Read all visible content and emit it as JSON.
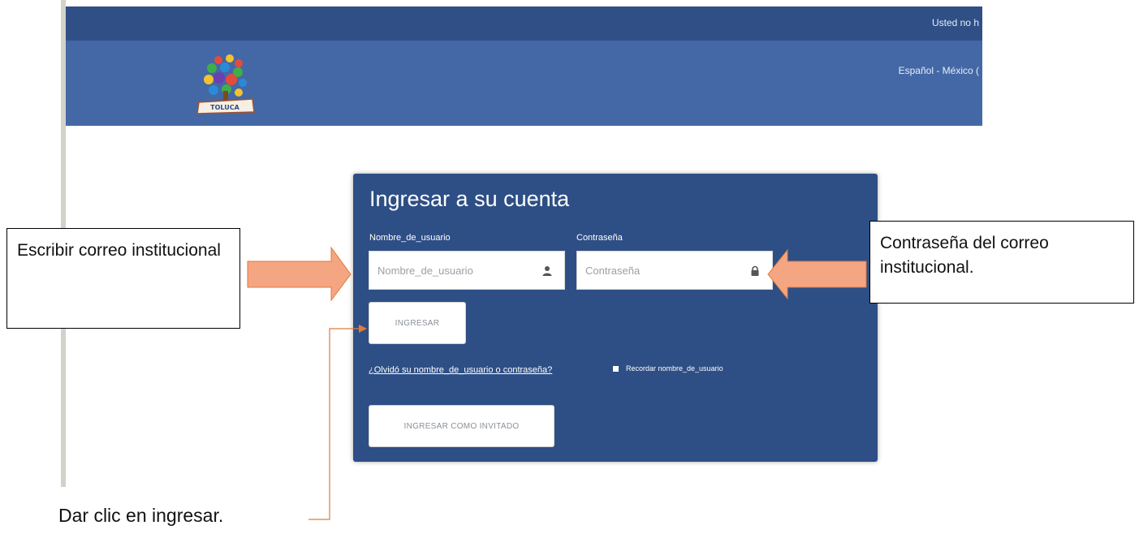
{
  "topbar": {
    "text": "Usted no h"
  },
  "header": {
    "logo_text": "TOLUCA",
    "language": "Español - México ("
  },
  "login": {
    "title": "Ingresar a su cuenta",
    "username_label": "Nombre_de_usuario",
    "username_placeholder": "Nombre_de_usuario",
    "password_label": "Contraseña",
    "password_placeholder": "Contraseña",
    "login_button": "INGRESAR",
    "forgot_link": "¿Olvidó su nombre_de_usuario o contraseña?",
    "remember_label": "Recordar nombre_de_usuario",
    "guest_button": "INGRESAR COMO INVITADO"
  },
  "annotations": {
    "left_callout": "Escribir correo institucional",
    "right_callout": "Contraseña del correo institucional.",
    "bottom_note": "Dar clic en ingresar.",
    "arrow_fill": "#f4a582",
    "arrow_stroke": "#e07b39",
    "line_color": "#e07b39"
  },
  "colors": {
    "topbar": "#2f4f86",
    "header": "#4468a6",
    "login_panel": "#2e4f85"
  },
  "icons": {
    "username_icon": "user-icon",
    "password_icon": "lock-icon",
    "logo": "toluca-logo"
  }
}
